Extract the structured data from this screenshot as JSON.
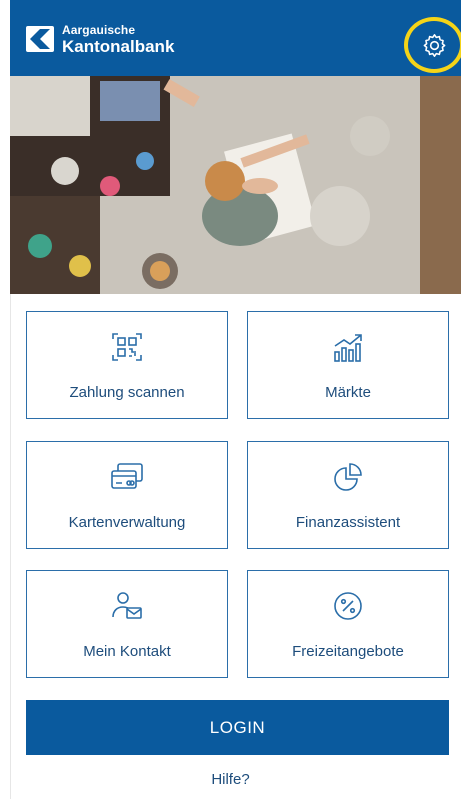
{
  "header": {
    "brand_line1": "Aargauische",
    "brand_line2": "Kantonalbank",
    "logo_icon": "akb-logo-icon",
    "settings_icon": "gear-icon",
    "highlight_color": "#f5d418",
    "bg_color": "#0a5a9e"
  },
  "hero": {
    "description_icon": "hero-photo"
  },
  "tiles": [
    {
      "label": "Zahlung scannen",
      "icon": "qr-scan-icon"
    },
    {
      "label": "Märkte",
      "icon": "market-chart-icon"
    },
    {
      "label": "Kartenverwaltung",
      "icon": "cards-icon"
    },
    {
      "label": "Finanzassistent",
      "icon": "pie-chart-icon"
    },
    {
      "label": "Mein Kontakt",
      "icon": "contact-icon"
    },
    {
      "label": "Freizeitangebote",
      "icon": "percent-icon"
    }
  ],
  "login": {
    "label": "LOGIN"
  },
  "help": {
    "label": "Hilfe?"
  }
}
